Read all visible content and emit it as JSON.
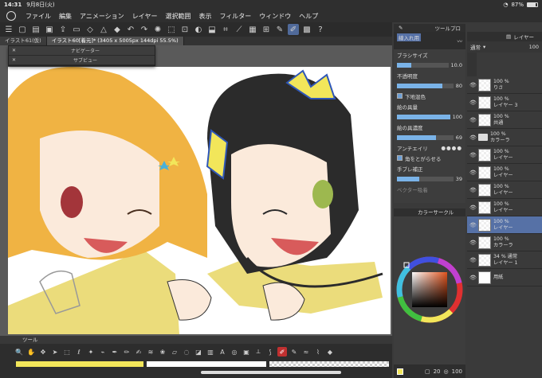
{
  "status": {
    "time": "14:31",
    "date": "9月8日(火)",
    "battery": "87%"
  },
  "menu": [
    "ファイル",
    "編集",
    "アニメーション",
    "レイヤー",
    "選択範囲",
    "表示",
    "フィルター",
    "ウィンドウ",
    "ヘルプ"
  ],
  "tabs": [
    {
      "label": "イラスト61(仮)"
    },
    {
      "label": "イラスト60[着元]* (3405 x 5005px 144dpi 55.5%)"
    }
  ],
  "subpanels": {
    "navigator": "ナビゲーター",
    "subview": "サブビュー"
  },
  "toolpanel": {
    "title": "ツール"
  },
  "brush": {
    "tab": "ツールプロ",
    "name": "線入れ用",
    "size_label": "ブラシサイズ",
    "size_value": "10.0",
    "opacity_label": "不透明度",
    "opacity_value": "80",
    "underlay_label": "下地混色",
    "paint_amount_label": "絵の具量",
    "paint_amount_value": "100",
    "paint_density_label": "絵の具濃度",
    "paint_density_value": "69",
    "antialias_label": "アンチエイリ",
    "corner_label": "角をとがらせる",
    "stabilize_label": "手ブレ補正",
    "stabilize_value": "39",
    "vector_label": "ベクター吸着",
    "opacity_fill": 0.8,
    "size_fill": 0.28,
    "paint_amount_fill": 1.0,
    "paint_density_fill": 0.69,
    "stabilize_fill": 0.39
  },
  "color": {
    "panel_title": "カラーサークル"
  },
  "layers": {
    "panel_title": "レイヤー",
    "blend": "通常",
    "opacity": "100",
    "items": [
      {
        "pct": "100 %",
        "name": "りさ",
        "thumb": "layer"
      },
      {
        "pct": "100 %",
        "name": "レイヤー 3",
        "thumb": "layer"
      },
      {
        "pct": "100 %",
        "name": "共通",
        "thumb": "layer"
      },
      {
        "pct": "100 %",
        "name": "カラーラ",
        "thumb": "folder"
      },
      {
        "pct": "100 %",
        "name": "レイヤー",
        "thumb": "layer"
      },
      {
        "pct": "100 %",
        "name": "レイヤー",
        "thumb": "layer"
      },
      {
        "pct": "100 %",
        "name": "レイヤー",
        "thumb": "layer"
      },
      {
        "pct": "100 %",
        "name": "レイヤー",
        "thumb": "layer"
      },
      {
        "pct": "100 %",
        "name": "レイヤー",
        "thumb": "layer",
        "selected": true
      },
      {
        "pct": "100 %",
        "name": "カラーラ",
        "thumb": "layer"
      },
      {
        "pct": "34 % 通常",
        "name": "レイヤー 1",
        "thumb": "layer"
      },
      {
        "pct": "",
        "name": "用紙",
        "thumb": "paper"
      }
    ]
  },
  "bottombar": {
    "num": "20",
    "zoom": "100"
  },
  "colors": {
    "accent": "#5671a6",
    "main_color": "#f2e65a"
  }
}
